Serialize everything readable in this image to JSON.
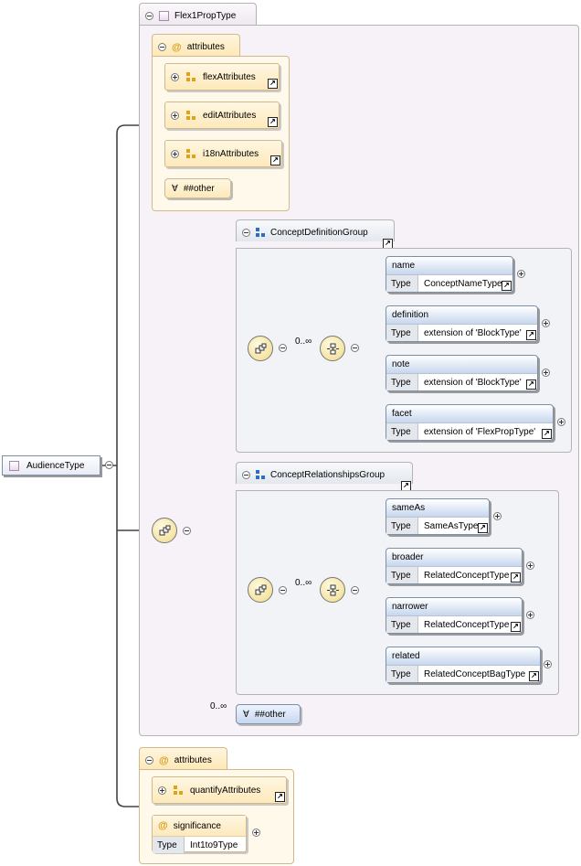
{
  "root": {
    "label": "AudienceType"
  },
  "complex_type": {
    "label": "Flex1PropType"
  },
  "attributes_group_1": {
    "tab_label": "attributes",
    "items": [
      {
        "label": "flexAttributes"
      },
      {
        "label": "editAttributes"
      },
      {
        "label": "i18nAttributes"
      }
    ],
    "any_other": "##other"
  },
  "concept_definition_group": {
    "label": "ConceptDefinitionGroup",
    "occurrence": "0..∞",
    "elements": [
      {
        "name": "name",
        "type_label": "Type",
        "type": "ConceptNameType"
      },
      {
        "name": "definition",
        "type_label": "Type",
        "type": "extension of 'BlockType'"
      },
      {
        "name": "note",
        "type_label": "Type",
        "type": "extension of 'BlockType'"
      },
      {
        "name": "facet",
        "type_label": "Type",
        "type": "extension of 'FlexPropType'"
      }
    ]
  },
  "concept_relationships_group": {
    "label": "ConceptRelationshipsGroup",
    "occurrence": "0..∞",
    "elements": [
      {
        "name": "sameAs",
        "type_label": "Type",
        "type": "SameAsType"
      },
      {
        "name": "broader",
        "type_label": "Type",
        "type": "RelatedConceptType"
      },
      {
        "name": "narrower",
        "type_label": "Type",
        "type": "RelatedConceptType"
      },
      {
        "name": "related",
        "type_label": "Type",
        "type": "RelatedConceptBagType"
      }
    ]
  },
  "any_element": {
    "occurrence": "0..∞",
    "label": "##other"
  },
  "attributes_group_2": {
    "tab_label": "attributes",
    "items": [
      {
        "label": "quantifyAttributes"
      }
    ],
    "attribute": {
      "name": "significance",
      "type_label": "Type",
      "type": "Int1to9Type"
    }
  },
  "colors": {
    "lilac": "#f7f2f8",
    "orange": "#fff9ec",
    "element_header": "#c7d7ee"
  }
}
